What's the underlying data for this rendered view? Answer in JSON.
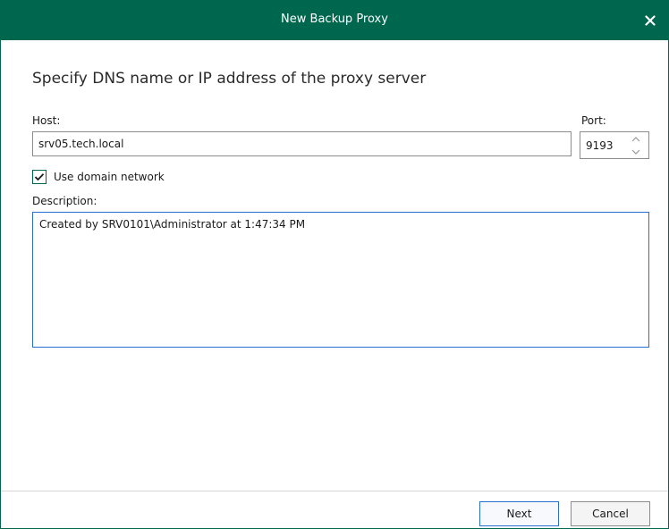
{
  "window": {
    "title": "New Backup Proxy"
  },
  "heading": "Specify DNS name or IP address of the proxy server",
  "host": {
    "label": "Host:",
    "value": "srv05.tech.local"
  },
  "port": {
    "label": "Port:",
    "value": "9193"
  },
  "domain_network": {
    "label": "Use domain network",
    "checked": true
  },
  "description": {
    "label": "Description:",
    "value": "Created by SRV0101\\Administrator at 1:47:34 PM"
  },
  "buttons": {
    "next": "Next",
    "cancel": "Cancel"
  },
  "colors": {
    "accent": "#00674f",
    "focus_border": "#2a6ecf"
  },
  "icons": {
    "close": "close-icon",
    "spin_up": "chevron-up-icon",
    "spin_down": "chevron-down-icon",
    "check": "check-icon"
  }
}
